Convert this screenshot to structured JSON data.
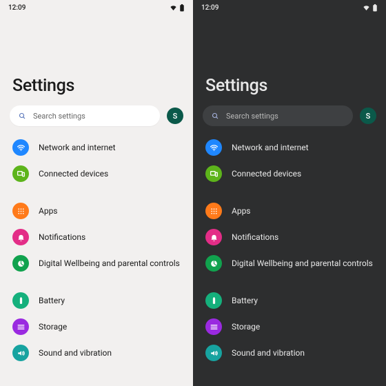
{
  "status": {
    "time": "12:09"
  },
  "page_title": "Settings",
  "search": {
    "placeholder": "Search settings"
  },
  "avatar": {
    "initial": "S"
  },
  "items": [
    {
      "label": "Network and internet",
      "color": "c-blue",
      "icon": "wifi"
    },
    {
      "label": "Connected devices",
      "color": "c-lime",
      "icon": "devices"
    },
    {
      "label": "Apps",
      "color": "c-orange",
      "icon": "apps",
      "gap_before": true
    },
    {
      "label": "Notifications",
      "color": "c-pink",
      "icon": "bell"
    },
    {
      "label": "Digital Wellbeing and parental controls",
      "color": "c-green",
      "icon": "wellbeing"
    },
    {
      "label": "Battery",
      "color": "c-teal",
      "icon": "battery",
      "gap_before": true
    },
    {
      "label": "Storage",
      "color": "c-purple",
      "icon": "storage"
    },
    {
      "label": "Sound and vibration",
      "color": "c-cyan",
      "icon": "sound"
    }
  ]
}
